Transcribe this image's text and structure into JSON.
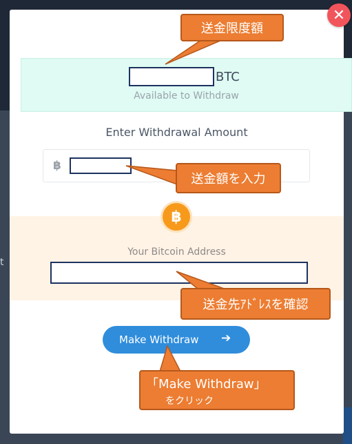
{
  "background": {
    "glyph": "t"
  },
  "dialog": {
    "available": {
      "unit": "BTC",
      "label": "Available to Withdraw"
    },
    "amount": {
      "title": "Enter Withdrawal Amount",
      "currency_symbol": "฿"
    },
    "coin_symbol": "฿",
    "address": {
      "label": "Your Bitcoin Address"
    },
    "submit": {
      "label": "Make Withdraw",
      "arrow": "➔"
    },
    "close_symbol": "✕"
  },
  "annotations": {
    "limit": "送金限度額",
    "amount": "送金額を入力",
    "address": "送金先ｱﾄﾞﾚｽを確認",
    "button_line1": "「Make Withdraw」",
    "button_line2": "をクリック"
  },
  "colors": {
    "callout": "#ec7d32",
    "button": "#2f8ddc",
    "close": "#f2545b",
    "available_panel": "#dffbf3",
    "address_panel": "#fff3e6",
    "bitcoin": "#f79a1c"
  }
}
